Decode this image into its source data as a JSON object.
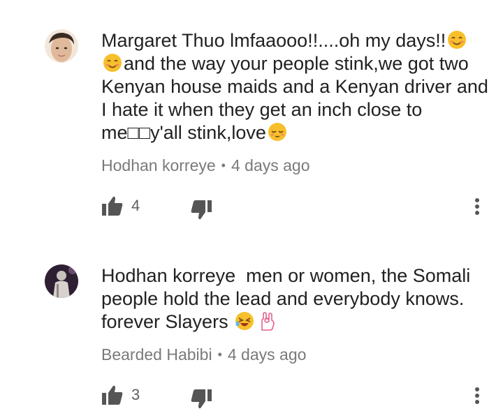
{
  "comments": [
    {
      "author": "Margaret Thuo",
      "text_part1": "lmfaaooo!!....oh my days!!",
      "text_part2": "and the way your people stink,we got two Kenyan house maids and a Kenyan driver and I hate it when they get an inch close to me",
      "text_part3": "y'all stink,love",
      "emoji_1": "smiling-face-icon",
      "emoji_2": "smiling-face-icon",
      "emoji_3": "relieved-face-icon",
      "reply_to": "Hodhan korreye",
      "separator": "•",
      "time": "4 days ago",
      "like_count": "4"
    },
    {
      "author": "Hodhan korreye",
      "text": "men or women, the Somali people hold the lead and everybody knows. forever Slayers",
      "emoji_1": "laughing-face-icon",
      "emoji_2": "ok-hand-icon",
      "reply_to": "Bearded Habibi",
      "separator": "•",
      "time": "4 days ago",
      "like_count": "3"
    }
  ],
  "colors": {
    "text": "#212121",
    "meta": "#7a7a7a",
    "icon": "#555555",
    "emoji_yellow": "#f7c02b"
  }
}
